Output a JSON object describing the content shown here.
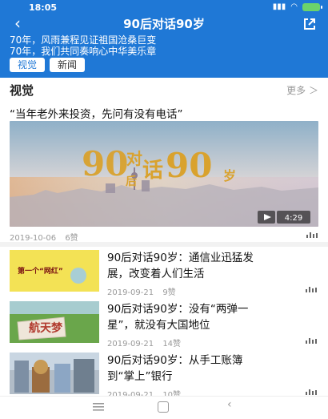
{
  "status": {
    "time": "18:05",
    "icons": [
      "signal-icon",
      "wifi-icon",
      "battery-icon"
    ]
  },
  "header": {
    "title": "90后对话90岁",
    "desc": [
      "70年，风雨兼程见证祖国沧桑巨变",
      "70年，我们共同奏响心中华美乐章"
    ],
    "tabs": [
      {
        "label": "视觉",
        "active": true
      },
      {
        "label": "新闻",
        "active": false
      }
    ]
  },
  "section": {
    "title": "视觉",
    "more": "更多 ＞"
  },
  "featured": {
    "title": "“当年老外来投资，先问有没有电话”",
    "image_text": {
      "main1": "90",
      "main2": "对",
      "main3": "话",
      "main4": "90",
      "main5": "岁",
      "sub": "后"
    },
    "duration": "4:29",
    "date": "2019-10-06",
    "likes": "6赞"
  },
  "items": [
    {
      "title_line1": "90后对话90岁：通信业迅猛发",
      "title_line2": "展，改变着人们生活",
      "date": "2019-09-21",
      "likes": "9赞",
      "thumb_text": "第一个“网红”"
    },
    {
      "title_line1": "90后对话90岁：没有“两弹一",
      "title_line2": "星”，就没有大国地位",
      "date": "2019-09-21",
      "likes": "14赞",
      "thumb_text": "航天梦"
    },
    {
      "title_line1": "90后对话90岁：从手工账簿",
      "title_line2": "到“掌上”银行",
      "date": "2019-09-21",
      "likes": "10赞",
      "thumb_text": ""
    }
  ],
  "colors": {
    "brand": "#1f78d6",
    "muted": "#999999"
  }
}
